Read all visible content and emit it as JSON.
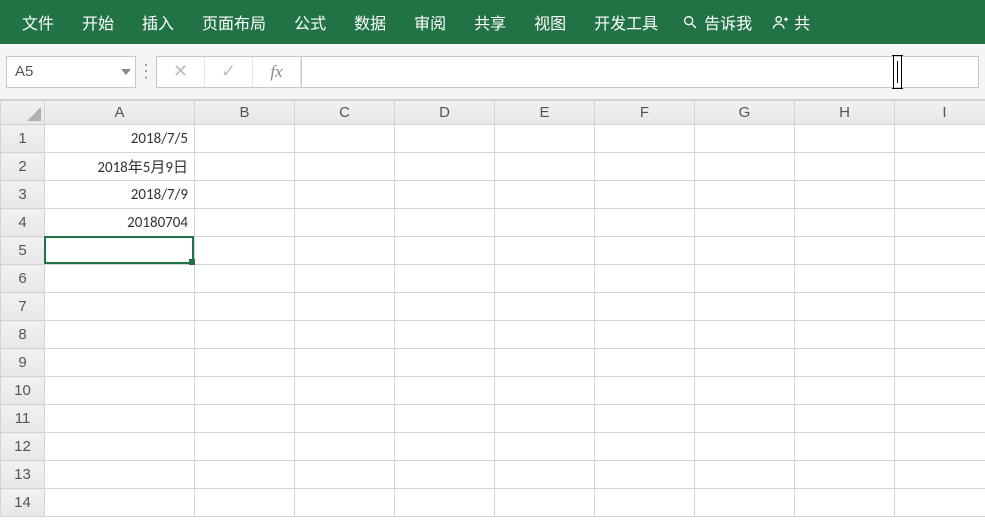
{
  "ribbon": {
    "tabs": [
      "文件",
      "开始",
      "插入",
      "页面布局",
      "公式",
      "数据",
      "审阅",
      "共享",
      "视图",
      "开发工具"
    ],
    "tell_me": "告诉我",
    "share": "共"
  },
  "formula_bar": {
    "name_box": "A5",
    "cancel_label": "✕",
    "confirm_label": "✓",
    "fx_label": "fx",
    "formula_value": ""
  },
  "grid": {
    "columns": [
      "A",
      "B",
      "C",
      "D",
      "E",
      "F",
      "G",
      "H",
      "I"
    ],
    "row_count": 14,
    "cells": {
      "A1": "2018/7/5",
      "A2": "2018年5月9日",
      "A3": "2018/7/9",
      "A4": "20180704"
    },
    "active": {
      "row": 5,
      "col": "A"
    }
  }
}
